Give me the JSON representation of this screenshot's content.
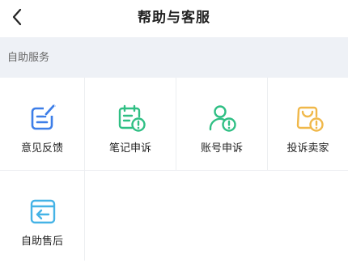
{
  "header": {
    "title": "帮助与客服"
  },
  "section": {
    "title": "自助服务"
  },
  "services": [
    {
      "label": "意见反馈",
      "icon": "feedback-icon",
      "color": "#3d7ee8"
    },
    {
      "label": "笔记申诉",
      "icon": "note-appeal-icon",
      "color": "#2fbf84"
    },
    {
      "label": "账号申诉",
      "icon": "account-appeal-icon",
      "color": "#2fbf84"
    },
    {
      "label": "投诉卖家",
      "icon": "complain-seller-icon",
      "color": "#f0b84a"
    },
    {
      "label": "自助售后",
      "icon": "after-sales-icon",
      "color": "#45b3e6"
    }
  ]
}
